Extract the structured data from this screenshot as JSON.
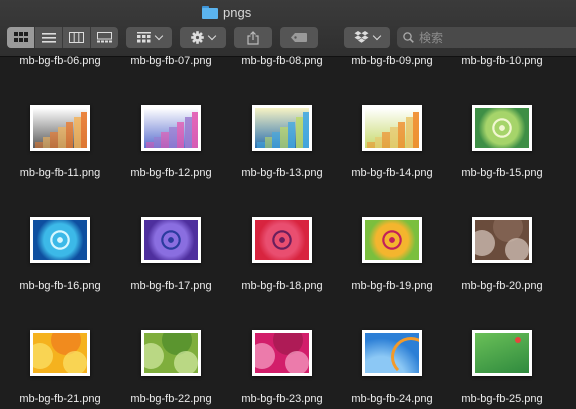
{
  "window": {
    "title": "pngs"
  },
  "toolbar": {
    "view_modes": [
      "icon-view",
      "list-view",
      "column-view",
      "gallery-view"
    ],
    "search_placeholder": "検索"
  },
  "files": [
    {
      "name": "mb-bg-fb-06.png"
    },
    {
      "name": "mb-bg-fb-07.png"
    },
    {
      "name": "mb-bg-fb-08.png"
    },
    {
      "name": "mb-bg-fb-09.png"
    },
    {
      "name": "mb-bg-fb-10.png"
    },
    {
      "name": "mb-bg-fb-11.png",
      "style": "stairs",
      "colors": [
        "#ffffff",
        "#f3b35a",
        "#ea7a2e",
        "#5a5a5a"
      ]
    },
    {
      "name": "mb-bg-fb-12.png",
      "style": "stairs",
      "colors": [
        "#ffffff",
        "#9b7bd0",
        "#e25ab2",
        "#5b6fcf"
      ]
    },
    {
      "name": "mb-bg-fb-13.png",
      "style": "stairs",
      "colors": [
        "#f7f3c4",
        "#bcd96a",
        "#45a9e0",
        "#2a6fb0"
      ]
    },
    {
      "name": "mb-bg-fb-14.png",
      "style": "stairs",
      "colors": [
        "#ffffff",
        "#e9c66a",
        "#f08a2a",
        "#c7d96c"
      ]
    },
    {
      "name": "mb-bg-fb-15.png",
      "style": "ring",
      "colors": [
        "#f2f7d2",
        "#a6d46a",
        "#3e8f46"
      ]
    },
    {
      "name": "mb-bg-fb-16.png",
      "style": "ring",
      "colors": [
        "#d8f7ff",
        "#3cb9e8",
        "#0e4fa0"
      ]
    },
    {
      "name": "mb-bg-fb-17.png",
      "style": "ring",
      "colors": [
        "#2a3b9e",
        "#8a6ee0",
        "#4e2f9e"
      ]
    },
    {
      "name": "mb-bg-fb-18.png",
      "style": "ring",
      "colors": [
        "#6a1e5c",
        "#e94e70",
        "#d8243f"
      ]
    },
    {
      "name": "mb-bg-fb-19.png",
      "style": "ring",
      "colors": [
        "#c21f5a",
        "#f4b52e",
        "#7bbf3e"
      ]
    },
    {
      "name": "mb-bg-fb-20.png",
      "style": "bubbles",
      "colors": [
        "#6a4c3c",
        "#d8c9bf",
        "#8a6b5a"
      ]
    },
    {
      "name": "mb-bg-fb-21.png",
      "style": "bubbles",
      "colors": [
        "#f5b21e",
        "#fbe26a",
        "#f07b1e"
      ]
    },
    {
      "name": "mb-bg-fb-22.png",
      "style": "bubbles",
      "colors": [
        "#7fae3c",
        "#d3eaa2",
        "#4b8a2a"
      ]
    },
    {
      "name": "mb-bg-fb-23.png",
      "style": "bubbles",
      "colors": [
        "#d21e6a",
        "#f7a3c7",
        "#9e1a4e"
      ]
    },
    {
      "name": "mb-bg-fb-24.png",
      "style": "arc",
      "colors": [
        "#2c7fd6",
        "#8cc8f5",
        "#f39a2a"
      ]
    },
    {
      "name": "mb-bg-fb-25.png",
      "style": "flat",
      "colors": [
        "#6ac058",
        "#2f8a3e",
        "#e8453c"
      ]
    }
  ]
}
